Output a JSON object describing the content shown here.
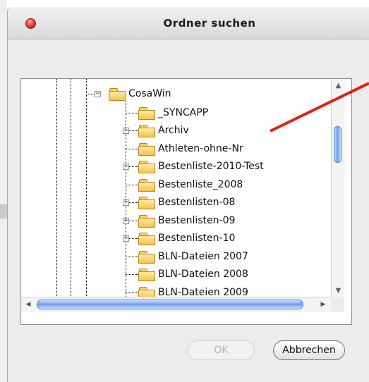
{
  "window": {
    "title": "Ordner suchen"
  },
  "tree": {
    "root": {
      "label": "CosaWin",
      "expanded": true
    },
    "children": [
      {
        "label": "_SYNCAPP",
        "expandable": false
      },
      {
        "label": "Archiv",
        "expandable": true
      },
      {
        "label": "Athleten-ohne-Nr",
        "expandable": false
      },
      {
        "label": "Bestenliste-2010-Test",
        "expandable": true
      },
      {
        "label": "Bestenliste_2008",
        "expandable": false
      },
      {
        "label": "Bestenlisten-08",
        "expandable": true
      },
      {
        "label": "Bestenlisten-09",
        "expandable": true
      },
      {
        "label": "Bestenlisten-10",
        "expandable": true
      },
      {
        "label": "BLN-Dateien 2007",
        "expandable": false
      },
      {
        "label": "BLN-Dateien 2008",
        "expandable": false
      },
      {
        "label": "BLN-Dateien 2009",
        "expandable": false
      }
    ]
  },
  "buttons": {
    "ok": "OK",
    "cancel": "Abbrechen"
  },
  "colors": {
    "annotation_arrow": "#e02010",
    "scroll_thumb": "#6a9fe8",
    "close_button": "#e2473b"
  },
  "icons": {
    "close": "close-icon",
    "folder": "folder-icon",
    "expand": "plus-icon",
    "collapse": "minus-icon"
  }
}
